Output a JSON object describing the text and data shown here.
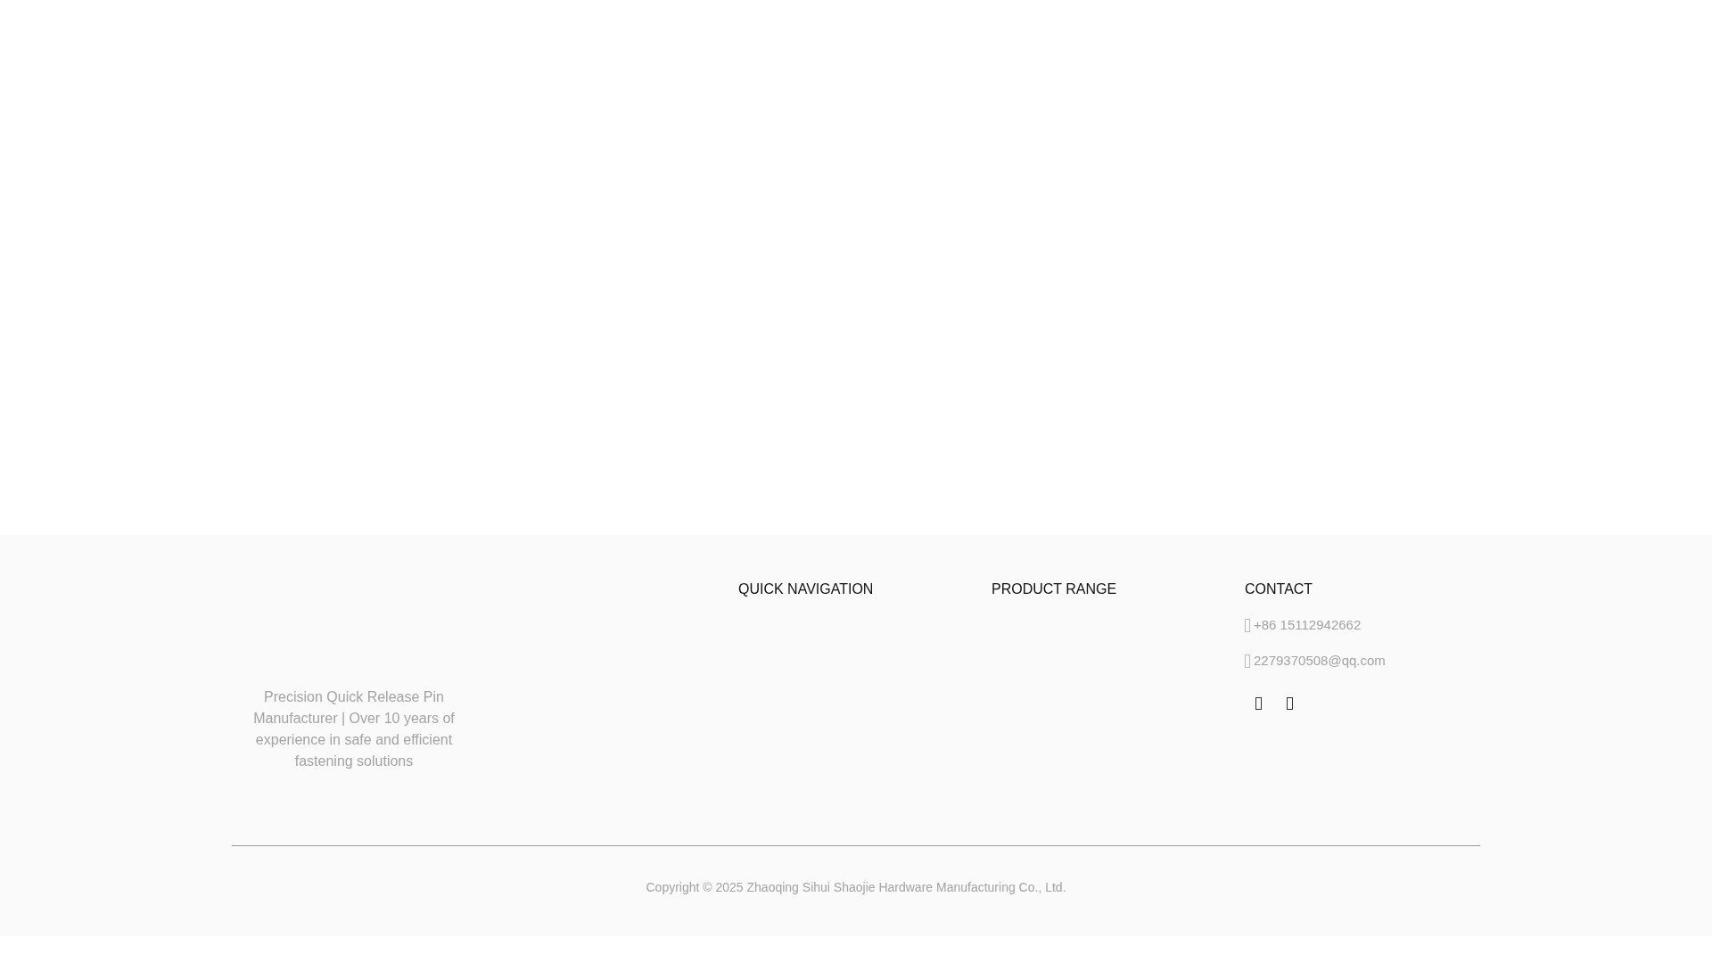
{
  "footer": {
    "description": "Precision Quick Release Pin Manufacturer | Over 10 years of experience in safe and efficient fastening solutions",
    "columns": [
      {
        "heading": "QUICK NAVIGATION"
      },
      {
        "heading": "PRODUCT RANGE"
      },
      {
        "heading": "CONTACT",
        "items": [
          {
            "text": "+86 15112942662"
          },
          {
            "text": "2279370508@qq.com"
          }
        ]
      }
    ],
    "copyright": "Copyright © 2025 Zhaoqing Sihui Shaojie Hardware Manufacturing Co., Ltd."
  }
}
